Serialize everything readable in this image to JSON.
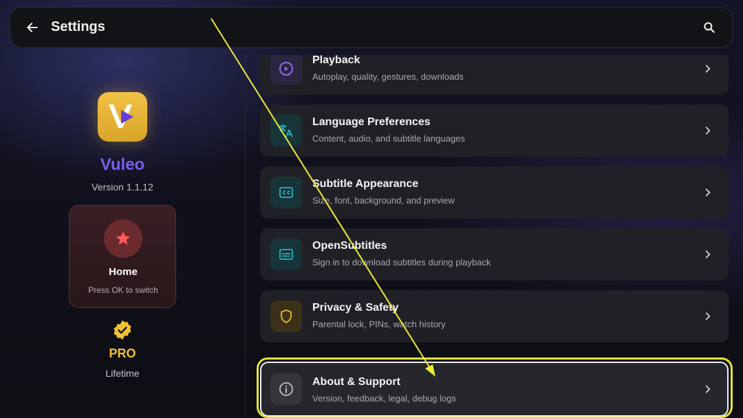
{
  "header": {
    "title": "Settings",
    "back_icon": "arrow-left-icon",
    "search_icon": "search-icon"
  },
  "sidebar": {
    "app_name": "Vuleo",
    "version": "Version 1.1.12",
    "home_card": {
      "label": "Home",
      "sub": "Press OK to switch",
      "icon": "star-icon"
    },
    "pro": {
      "label": "PRO",
      "sub": "Lifetime",
      "icon": "verified-badge-icon"
    }
  },
  "items": [
    {
      "title": "Playback",
      "subtitle": "Autoplay, quality, gestures, downloads",
      "icon": "play-circle-icon",
      "accent": "#8f6cf0"
    },
    {
      "title": "Language Preferences",
      "subtitle": "Content, audio, and subtitle languages",
      "icon": "translate-icon",
      "accent": "#2bb3c0"
    },
    {
      "title": "Subtitle Appearance",
      "subtitle": "Size, font, background, and preview",
      "icon": "closed-caption-icon",
      "accent": "#2bb3c0"
    },
    {
      "title": "OpenSubtitles",
      "subtitle": "Sign in to download subtitles during playback",
      "icon": "subtitles-icon",
      "accent": "#2bb3c0"
    },
    {
      "title": "Privacy & Safety",
      "subtitle": "Parental lock, PINs, watch history",
      "icon": "shield-icon",
      "accent": "#e8b52f"
    },
    {
      "title": "About & Support",
      "subtitle": "Version, feedback, legal, debug logs",
      "icon": "info-icon",
      "accent": "#bdbdc2"
    }
  ],
  "colors": {
    "brand_purple": "#7c5cf0",
    "pro_gold": "#f2c033",
    "focus_ring": "#e6e337"
  }
}
